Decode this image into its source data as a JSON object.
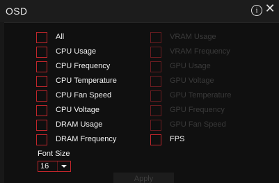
{
  "window": {
    "title": "OSD",
    "info_glyph": "i",
    "close_glyph": "✕"
  },
  "left_options": [
    {
      "label": "All",
      "enabled": true
    },
    {
      "label": "CPU Usage",
      "enabled": true
    },
    {
      "label": "CPU Frequency",
      "enabled": true
    },
    {
      "label": "CPU Temperature",
      "enabled": true
    },
    {
      "label": "CPU Fan Speed",
      "enabled": true
    },
    {
      "label": "CPU Voltage",
      "enabled": true
    },
    {
      "label": "DRAM Usage",
      "enabled": true
    },
    {
      "label": "DRAM Frequency",
      "enabled": true
    }
  ],
  "right_options": [
    {
      "label": "VRAM Usage",
      "enabled": false
    },
    {
      "label": "VRAM Frequency",
      "enabled": false
    },
    {
      "label": "GPU Usage",
      "enabled": false
    },
    {
      "label": "GPU Voltage",
      "enabled": false
    },
    {
      "label": "GPU Temperature",
      "enabled": false
    },
    {
      "label": "GPU Frequency",
      "enabled": false
    },
    {
      "label": "GPU Fan Speed",
      "enabled": false
    },
    {
      "label": "FPS",
      "enabled": true
    }
  ],
  "font_size": {
    "label": "Font Size",
    "value": "16"
  },
  "apply_label": "Apply",
  "colors": {
    "accent_red": "#c0262b",
    "background": "#101010",
    "titlebar": "#1c1c1c",
    "text": "#f2f2f2",
    "disabled_text": "#3a3a3a"
  }
}
